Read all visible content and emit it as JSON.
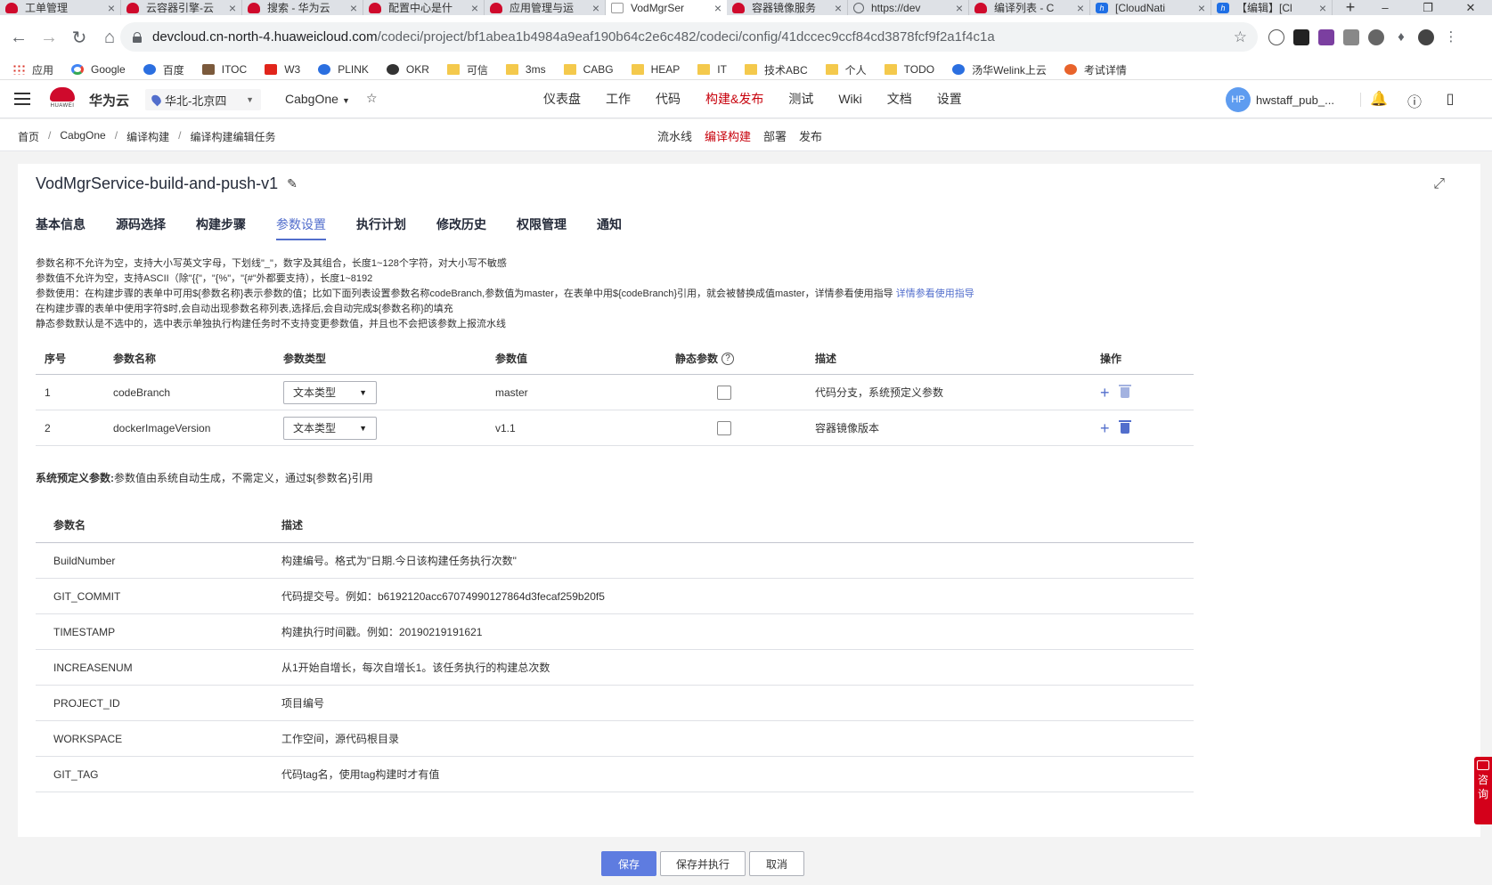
{
  "browser": {
    "tabs": [
      {
        "title": "工单管理",
        "icon": "huawei-logo-icon"
      },
      {
        "title": "云容器引擎-云",
        "icon": "huawei-logo-icon"
      },
      {
        "title": "搜索 - 华为云",
        "icon": "huawei-logo-icon"
      },
      {
        "title": "配置中心是什",
        "icon": "huawei-logo-icon"
      },
      {
        "title": "应用管理与运",
        "icon": "huawei-logo-icon"
      },
      {
        "title": "VodMgrSer",
        "icon": "page-icon",
        "active": true
      },
      {
        "title": "容器镜像服务",
        "icon": "huawei-logo-icon"
      },
      {
        "title": "https://dev",
        "icon": "globe-icon"
      },
      {
        "title": "编译列表 - C",
        "icon": "huawei-logo-icon"
      },
      {
        "title": "[CloudNati",
        "icon": "welink-icon"
      },
      {
        "title": "【编辑】[Cl",
        "icon": "welink-icon"
      }
    ],
    "new_tab": "+",
    "url_host": "devcloud.cn-north-4.huaweicloud.com",
    "url_path": "/codeci/project/bf1abea1b4984a9eaf190b64c2e6c482/codeci/config/41dccec9ccf84cd3878fcf9f2a1f4c1a",
    "bookmarks": [
      {
        "label": "应用",
        "icon": "apps-grid-icon"
      },
      {
        "label": "Google",
        "icon": "google-icon"
      },
      {
        "label": "百度",
        "icon": "baidu-icon"
      },
      {
        "label": "ITOC",
        "icon": "itoc-icon"
      },
      {
        "label": "W3",
        "icon": "w3-icon"
      },
      {
        "label": "PLINK",
        "icon": "plink-icon"
      },
      {
        "label": "OKR",
        "icon": "okr-icon"
      },
      {
        "label": "可信",
        "icon": "folder-icon"
      },
      {
        "label": "3ms",
        "icon": "folder-icon"
      },
      {
        "label": "CABG",
        "icon": "folder-icon"
      },
      {
        "label": "HEAP",
        "icon": "folder-icon"
      },
      {
        "label": "IT",
        "icon": "folder-icon"
      },
      {
        "label": "技术ABC",
        "icon": "folder-icon"
      },
      {
        "label": "个人",
        "icon": "folder-icon"
      },
      {
        "label": "TODO",
        "icon": "folder-icon"
      },
      {
        "label": "汤华Welink上云",
        "icon": "welink-icon"
      },
      {
        "label": "考试详情",
        "icon": "exam-icon"
      }
    ]
  },
  "header": {
    "logo_text": "HUAWEI",
    "brand": "华为云",
    "region": "华北-北京四",
    "project": "CabgOne",
    "nav": [
      "仪表盘",
      "工作",
      "代码",
      "构建&发布",
      "测试",
      "Wiki",
      "文档",
      "设置"
    ],
    "nav_active": "构建&发布",
    "user_initials": "HP",
    "user_name": "hwstaff_pub_..."
  },
  "breadcrumb": [
    "首页",
    "CabgOne",
    "编译构建",
    "编译构建编辑任务"
  ],
  "subnav": [
    "流水线",
    "编译构建",
    "部署",
    "发布"
  ],
  "page": {
    "title": "VodMgrService-build-and-push-v1",
    "tabs": [
      "基本信息",
      "源码选择",
      "构建步骤",
      "参数设置",
      "执行计划",
      "修改历史",
      "权限管理",
      "通知"
    ],
    "active_tab": "参数设置",
    "notes": [
      "参数名称不允许为空，支持大小写英文字母，下划线\"_\"，数字及其组合，长度1~128个字符，对大小写不敏感",
      "参数值不允许为空，支持ASCII（除\"{{\"，\"{%\"，\"{#\"外都要支持），长度1~8192",
      "参数使用：在构建步骤的表单中可用${参数名称}表示参数的值；比如下面列表设置参数名称codeBranch,参数值为master，在表单中用${codeBranch}引用，就会被替换成值master，详情参看使用指导",
      "在构建步骤的表单中使用字符$时,会自动出现参数名称列表,选择后,会自动完成${参数名称}的填充",
      "静态参数默认是不选中的，选中表示单独执行构建任务时不支持变更参数值，并且也不会把该参数上报流水线"
    ],
    "notes_link": "详情参看使用指导",
    "params_table": {
      "headers": [
        "序号",
        "参数名称",
        "参数类型",
        "参数值",
        "静态参数",
        "描述",
        "操作"
      ],
      "rows": [
        {
          "no": "1",
          "name": "codeBranch",
          "type": "文本类型",
          "value": "master",
          "static": false,
          "desc": "代码分支，系统预定义参数"
        },
        {
          "no": "2",
          "name": "dockerImageVersion",
          "type": "文本类型",
          "value": "v1.1",
          "static": false,
          "desc": "容器镜像版本"
        }
      ]
    },
    "sys_note_label": "系统预定义参数:",
    "sys_note_text": "参数值由系统自动生成，不需定义，通过${参数名}引用",
    "sys_table": {
      "headers": [
        "参数名",
        "描述"
      ],
      "rows": [
        {
          "name": "BuildNumber",
          "desc": "构建编号。格式为\"日期.今日该构建任务执行次数\""
        },
        {
          "name": "GIT_COMMIT",
          "desc": "代码提交号。例如：b6192120acc67074990127864d3fecaf259b20f5"
        },
        {
          "name": "TIMESTAMP",
          "desc": "构建执行时间戳。例如：20190219191621"
        },
        {
          "name": "INCREASENUM",
          "desc": "从1开始自增长，每次自增长1。该任务执行的构建总次数"
        },
        {
          "name": "PROJECT_ID",
          "desc": "项目编号"
        },
        {
          "name": "WORKSPACE",
          "desc": "工作空间，源代码根目录"
        },
        {
          "name": "GIT_TAG",
          "desc": "代码tag名，使用tag构建时才有值"
        }
      ]
    },
    "buttons": {
      "save": "保存",
      "save_run": "保存并执行",
      "cancel": "取消"
    }
  },
  "consult": "咨询",
  "colors": {
    "accent": "#526ecc",
    "brand_red": "#c7000b",
    "primary_btn": "#5e7ce0"
  }
}
